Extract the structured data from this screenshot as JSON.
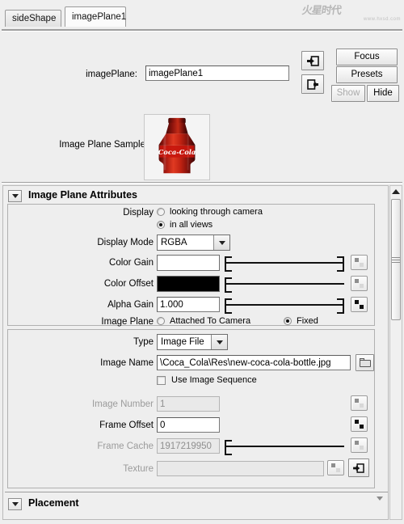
{
  "window": {
    "watermark_text": "火星时代",
    "watermark_sub": "www.hxsd.com"
  },
  "tabs": [
    {
      "label": "sideShape",
      "active": false
    },
    {
      "label": "imagePlane1",
      "active": true
    }
  ],
  "header": {
    "image_plane_label": "imagePlane:",
    "image_plane_value": "imagePlane1",
    "focus_label": "Focus",
    "presets_label": "Presets",
    "show_label": "Show",
    "hide_label": "Hide",
    "icon_in": "arrow-into-box-icon",
    "icon_out": "arrow-out-of-box-icon"
  },
  "sample": {
    "label": "Image Plane Sample",
    "image_alt": "coca-cola-bottle-thumbnail"
  },
  "attributes": {
    "section_title": "Image Plane Attributes",
    "display_label": "Display",
    "display_options": [
      {
        "label": "looking through camera",
        "selected": false
      },
      {
        "label": "in all views",
        "selected": true
      }
    ],
    "display_mode_label": "Display Mode",
    "display_mode_value": "RGBA",
    "color_gain_label": "Color Gain",
    "color_gain_color": "#ffffff",
    "color_gain_slider": 100,
    "color_offset_label": "Color Offset",
    "color_offset_color": "#000000",
    "color_offset_slider": 0,
    "alpha_gain_label": "Alpha Gain",
    "alpha_gain_value": "1.000",
    "alpha_gain_slider": 100,
    "image_plane_label": "Image Plane",
    "image_plane_options": [
      {
        "label": "Attached To Camera",
        "selected": false
      },
      {
        "label": "Fixed",
        "selected": true
      }
    ]
  },
  "file": {
    "type_label": "Type",
    "type_value": "Image File",
    "image_name_label": "Image Name",
    "image_name_value": "\\Coca_Cola\\Res\\new-coca-cola-bottle.jpg",
    "browse_icon": "folder-icon",
    "use_image_sequence_label": "Use Image Sequence",
    "use_image_sequence_checked": false,
    "image_number_label": "Image Number",
    "image_number_value": "1",
    "image_number_disabled": true,
    "frame_offset_label": "Frame Offset",
    "frame_offset_value": "0",
    "frame_cache_label": "Frame Cache",
    "frame_cache_value": "1917219950",
    "frame_cache_disabled": true,
    "frame_cache_slider": 2,
    "texture_label": "Texture",
    "texture_value": "",
    "texture_disabled": true
  },
  "placement": {
    "section_title": "Placement"
  },
  "colors": {
    "panel_bg": "#efefef",
    "field_bg": "#ffffff",
    "disabled_text": "#8f8f8f",
    "border": "#8c8c8c"
  }
}
